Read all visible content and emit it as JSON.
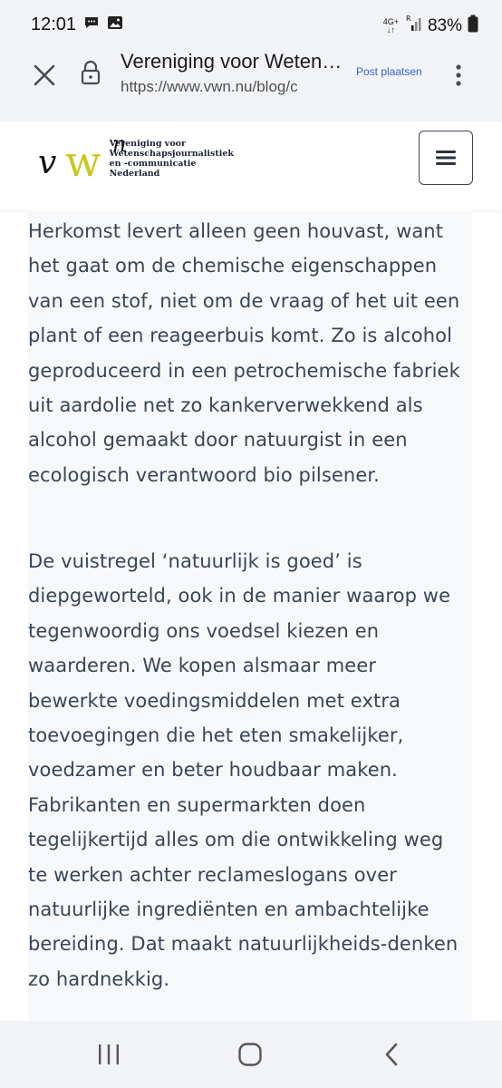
{
  "status_bar": {
    "time": "12:01",
    "left_icons": [
      "chat-bubble-icon",
      "image-icon"
    ],
    "network_label": "4G+",
    "roaming_label": "R",
    "battery_percent": "83%"
  },
  "toolbar": {
    "title": "Vereniging voor Wetenschapsjournalistiek en -communicatie Nederland",
    "url": "https://www.vwn.nu/blog/c",
    "action_label": "Post plaatsen"
  },
  "site_header": {
    "logo_letters": {
      "v": "v",
      "w": "w",
      "n": "n"
    },
    "logo_text": [
      "Vereniging voor",
      "Wetenschapsjournalistiek",
      "en -communicatie",
      "Nederland"
    ]
  },
  "article": {
    "paragraphs": [
      {
        "lines": [
          "Herkomst levert alleen geen houvast, want",
          "het gaat om de chemische eigenschappen",
          "van een stof, niet om de vraag of het uit een",
          "plant of een reageerbuis komt. Zo is alcohol",
          "geproduceerd in een petrochemische fabriek",
          "uit aardolie net zo kankerverwekkend als",
          "alcohol gemaakt door natuurgist in een",
          "ecologisch verantwoord bio pilsener."
        ]
      },
      {
        "lines": [
          "De vuistregel ‘natuurlijk is goed’ is",
          "diepgeworteld, ook in de manier waarop we",
          "tegenwoordig ons voedsel kiezen en",
          "waarderen. We kopen alsmaar meer",
          "bewerkte voedingsmiddelen met extra",
          "toevoegingen die het eten smakelijker,",
          "voedzamer en beter houdbaar maken.",
          "Fabrikanten en supermarkten doen",
          "tegelijkertijd alles om die ontwikkeling weg",
          "te werken achter reclameslogans over",
          "natuurlijke ingrediënten en ambachtelijke",
          "bereiding. Dat maakt natuurlijkheids-denken",
          "zo hardnekkig."
        ]
      }
    ]
  },
  "colors": {
    "body_text": "#3a4555",
    "content_bg": "#f7f8fa",
    "logo_w": "#c8c81e",
    "link_blue": "#2f63d1"
  }
}
